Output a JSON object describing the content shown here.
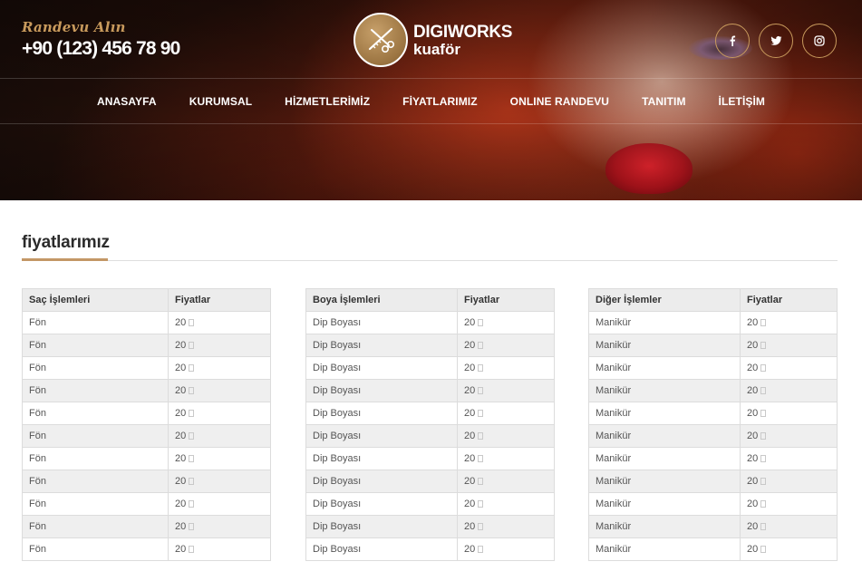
{
  "header": {
    "appointment_label": "Randevu Alın",
    "phone": "+90 (123) 456 78 90",
    "logo_title": "DIGIWORKS",
    "logo_subtitle": "kuaför",
    "social": [
      {
        "icon": "facebook-icon",
        "glyph": "f"
      },
      {
        "icon": "twitter-icon",
        "glyph": "t"
      },
      {
        "icon": "instagram-icon",
        "glyph": "i"
      }
    ]
  },
  "nav": {
    "items": [
      "ANASAYFA",
      "KURUMSAL",
      "HİZMETLERİMİZ",
      "FİYATLARIMIZ",
      "ONLINE RANDEVU",
      "TANITIM",
      "İLETİŞİM"
    ]
  },
  "section": {
    "title": "fiyatlarımız"
  },
  "tables": [
    {
      "headers": [
        "Saç İşlemleri",
        "Fiyatlar"
      ],
      "rows": [
        [
          "Fön",
          "20"
        ],
        [
          "Fön",
          "20"
        ],
        [
          "Fön",
          "20"
        ],
        [
          "Fön",
          "20"
        ],
        [
          "Fön",
          "20"
        ],
        [
          "Fön",
          "20"
        ],
        [
          "Fön",
          "20"
        ],
        [
          "Fön",
          "20"
        ],
        [
          "Fön",
          "20"
        ],
        [
          "Fön",
          "20"
        ],
        [
          "Fön",
          "20"
        ]
      ]
    },
    {
      "headers": [
        "Boya İşlemleri",
        "Fiyatlar"
      ],
      "rows": [
        [
          "Dip Boyası",
          "20"
        ],
        [
          "Dip Boyası",
          "20"
        ],
        [
          "Dip Boyası",
          "20"
        ],
        [
          "Dip Boyası",
          "20"
        ],
        [
          "Dip Boyası",
          "20"
        ],
        [
          "Dip Boyası",
          "20"
        ],
        [
          "Dip Boyası",
          "20"
        ],
        [
          "Dip Boyası",
          "20"
        ],
        [
          "Dip Boyası",
          "20"
        ],
        [
          "Dip Boyası",
          "20"
        ],
        [
          "Dip Boyası",
          "20"
        ]
      ]
    },
    {
      "headers": [
        "Diğer İşlemler",
        "Fiyatlar"
      ],
      "rows": [
        [
          "Manikür",
          "20"
        ],
        [
          "Manikür",
          "20"
        ],
        [
          "Manikür",
          "20"
        ],
        [
          "Manikür",
          "20"
        ],
        [
          "Manikür",
          "20"
        ],
        [
          "Manikür",
          "20"
        ],
        [
          "Manikür",
          "20"
        ],
        [
          "Manikür",
          "20"
        ],
        [
          "Manikür",
          "20"
        ],
        [
          "Manikür",
          "20"
        ],
        [
          "Manikür",
          "20"
        ]
      ]
    }
  ],
  "colors": {
    "accent_gold": "#c89a5c",
    "title_underline": "#c39766"
  }
}
